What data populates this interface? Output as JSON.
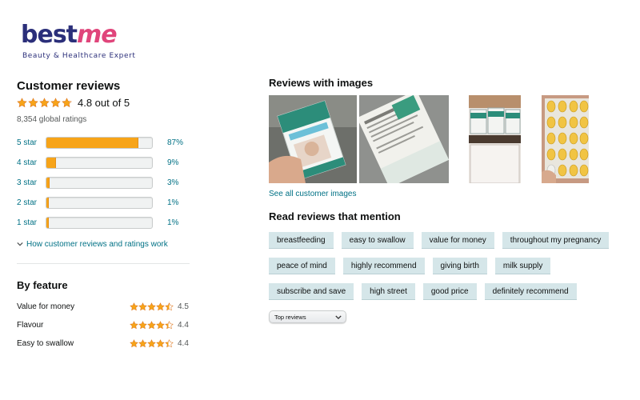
{
  "logo": {
    "word_best": "best",
    "word_me": "me",
    "tagline": "Beauty & Healthcare Expert"
  },
  "summary": {
    "title": "Customer reviews",
    "rating_text": "4.8 out of 5",
    "rating_value": 4.8,
    "global_ratings": "8,354 global ratings"
  },
  "histogram": [
    {
      "label": "5 star",
      "percent": "87%",
      "fraction": 0.87
    },
    {
      "label": "4 star",
      "percent": "9%",
      "fraction": 0.09
    },
    {
      "label": "3 star",
      "percent": "3%",
      "fraction": 0.03
    },
    {
      "label": "2 star",
      "percent": "1%",
      "fraction": 0.01
    },
    {
      "label": "1 star",
      "percent": "1%",
      "fraction": 0.01
    }
  ],
  "how_link": "How customer reviews and ratings work",
  "features": {
    "title": "By feature",
    "items": [
      {
        "name": "Value for money",
        "value": "4.5",
        "rating": 4.5
      },
      {
        "name": "Flavour",
        "value": "4.4",
        "rating": 4.4
      },
      {
        "name": "Easy to swallow",
        "value": "4.4",
        "rating": 4.4
      }
    ]
  },
  "images_section": {
    "title": "Reviews with images",
    "see_all": "See all customer images"
  },
  "mentions": {
    "title": "Read reviews that mention",
    "rows": [
      [
        "breastfeeding",
        "easy to swallow",
        "value for money",
        "throughout my pregnancy"
      ],
      [
        "peace of mind",
        "highly recommend",
        "giving birth",
        "milk supply"
      ],
      [
        "subscribe and save",
        "high street",
        "good price",
        "definitely recommend"
      ]
    ]
  },
  "sort": {
    "selected": "Top reviews"
  },
  "colors": {
    "star": "#f7a419",
    "link": "#007185",
    "chip": "#d5e6e9"
  }
}
